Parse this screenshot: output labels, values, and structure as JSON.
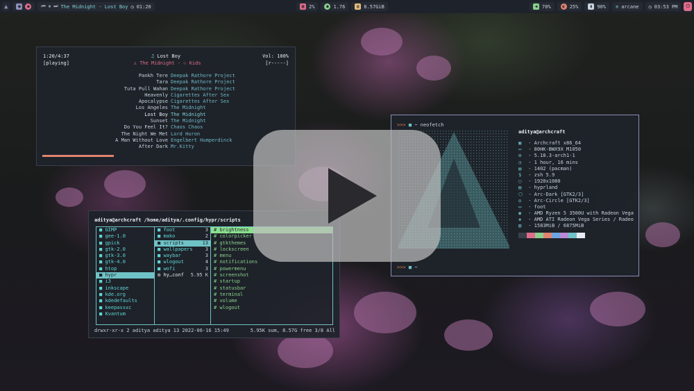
{
  "topbar": {
    "track": "The Midnight - Lost Boy",
    "time": "01:20",
    "cpu": "2%",
    "load": "1.76",
    "mem": "8.57GiB",
    "volume": "70%",
    "brightness": "25%",
    "battery": "90%",
    "wifi": "arcane",
    "clock": "03:53 PM"
  },
  "music": {
    "position": "1:20/4:37",
    "state": "[playing]",
    "song": "Lost Boy",
    "artist_album": "The Midnight - ☉ Kids",
    "volume": "Vol: 100%",
    "mode": "[r-----]",
    "playlist": [
      {
        "title": "Pankh Tere",
        "artist": "Deepak Rathore Project"
      },
      {
        "title": "Tara",
        "artist": "Deepak Rathore Project"
      },
      {
        "title": "Tuta Pull Wahan",
        "artist": "Deepak Rathore Project"
      },
      {
        "title": "Heavenly",
        "artist": "Cigarettes After Sex"
      },
      {
        "title": "Apocalypse",
        "artist": "Cigarettes After Sex"
      },
      {
        "title": "Los Angeles",
        "artist": "The Midnight"
      },
      {
        "title": "Lost Boy",
        "artist": "The Midnight"
      },
      {
        "title": "Sunset",
        "artist": "The Midnight"
      },
      {
        "title": "Do You Feel It?",
        "artist": "Chaos Chaos"
      },
      {
        "title": "The Night We Met",
        "artist": "Lord Huron"
      },
      {
        "title": "A Man Without Love",
        "artist": "Engelbert Humperdinck"
      },
      {
        "title": "After Dark",
        "artist": "Mr.Kitty"
      }
    ],
    "progress": 0.29
  },
  "files": {
    "user": "aditya@archcraft",
    "path": "/home/aditya/.config/hypr/scripts",
    "col1": [
      "GIMP",
      "gee-1.0",
      "gpick",
      "gtk-2.0",
      "gtk-3.0",
      "gtk-4.0",
      "htop",
      "hypr",
      "i3",
      "inkscape",
      "kde.org",
      "kdedefaults",
      "keepassxc",
      "Kvantum"
    ],
    "col2": [
      {
        "name": "foot",
        "count": "3"
      },
      {
        "name": "mako",
        "count": "2"
      },
      {
        "name": "scripts",
        "count": "13"
      },
      {
        "name": "wallpapers",
        "count": "3"
      },
      {
        "name": "waybar",
        "count": "3"
      },
      {
        "name": "wlogout",
        "count": "4"
      },
      {
        "name": "wofi",
        "count": "3"
      },
      {
        "name": "hy…conf",
        "count": "5.95 K"
      }
    ],
    "col3": [
      "brightness",
      "colorpicker",
      "gtkthemes",
      "lockscreen",
      "menu",
      "notifications",
      "powermenu",
      "screenshot",
      "startup",
      "statusbar",
      "terminal",
      "volume",
      "wlogout"
    ],
    "status_left": "drwxr-xr-x 2 aditya aditya 13 2022-06-16 15:49",
    "status_right": "5.95K sum, 8.57G free  3/8  All"
  },
  "neofetch": {
    "command": "neofetch",
    "user": "aditya@archcraft",
    "rows": [
      "Archcraft x86_64",
      "80HK-BWX9X M1050",
      "5.18.3-arch1-1",
      "1 hour, 16 mins",
      "1402 (pacman)",
      "zsh 5.9",
      "1920x1080",
      "hyprland",
      "Arc-Dark [GTK2/3]",
      "Arc-Circle [GTK2/3]",
      "foot",
      "AMD Ryzen 5 3500U with Radeon Vega",
      "AMD ATI Radeon Vega Series / Radeo",
      "1583MiB / 6875MiB"
    ],
    "palette": [
      "#3a3f4b",
      "#e06c8a",
      "#8ad08e",
      "#e0846f",
      "#6fa4e0",
      "#b98ad8",
      "#6fc3c6",
      "#e8ecf2"
    ]
  }
}
